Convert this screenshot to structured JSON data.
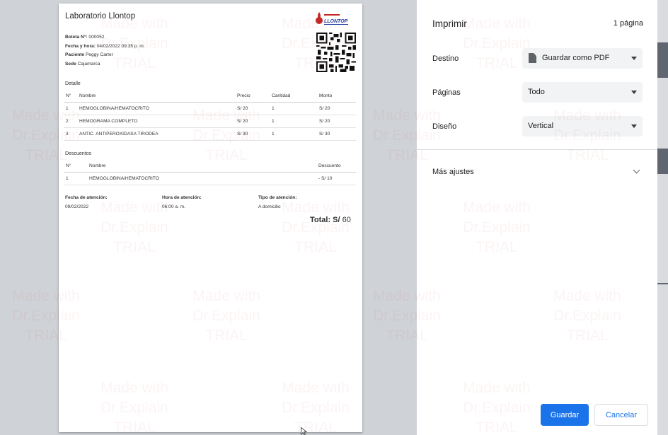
{
  "document": {
    "lab_name": "Laboratorio Llontop",
    "logo_text": "LLONTOP",
    "boleta_label": "Boleta N°:",
    "boleta_value": "000052",
    "fecha_label": "Fecha y hora:",
    "fecha_value": "04/02/2022 09:35 p. m.",
    "paciente_label": "Paciente",
    "paciente_value": "Peggy Carter",
    "sede_label": "Sede",
    "sede_value": "Cajamarca",
    "detalle_title": "Detalle",
    "detalle_headers": [
      "N°",
      "Nombre",
      "Precio",
      "Cantidad",
      "Monto"
    ],
    "detalle_rows": [
      [
        "1",
        "HEMOGLOBINA/HEMATOCRITO",
        "S/ 20",
        "1",
        "S/ 20"
      ],
      [
        "2",
        "HEMOGRAMA COMPLETO",
        "S/ 20",
        "1",
        "S/ 20"
      ],
      [
        "3",
        "ANTIC. ANTIPEROXIDASA TIRODEA",
        "S/ 30",
        "1",
        "S/ 30"
      ]
    ],
    "descuentos_title": "Descuentos",
    "descuentos_headers": [
      "N°",
      "Nombre",
      "Descuento"
    ],
    "descuentos_rows": [
      [
        "1",
        "HEMOGLOBINA/HEMATOCRITO",
        "- S/ 10"
      ]
    ],
    "fecha_atencion_label": "Fecha de atención:",
    "fecha_atencion_value": "09/02/2022",
    "hora_atencion_label": "Hora de atención:",
    "hora_atencion_value": "06:00 a. m.",
    "tipo_atencion_label": "Tipo de atención:",
    "tipo_atencion_value": "A domicilio",
    "total_label": "Total: S/",
    "total_value": "60"
  },
  "print_panel": {
    "title": "Imprimir",
    "page_count": "1 página",
    "destino_label": "Destino",
    "destino_value": "Guardar como PDF",
    "paginas_label": "Páginas",
    "paginas_value": "Todo",
    "diseno_label": "Diseño",
    "diseno_value": "Vertical",
    "more_settings": "Más ajustes",
    "save_button": "Guardar",
    "cancel_button": "Cancelar"
  },
  "watermark": {
    "line1": "Made with",
    "line2": "Dr.Explain",
    "line3": "TRIAL"
  },
  "colors": {
    "accent": "#1a73e8",
    "backdrop": "#c9ccd1",
    "select_bg": "#f1f3f4"
  }
}
